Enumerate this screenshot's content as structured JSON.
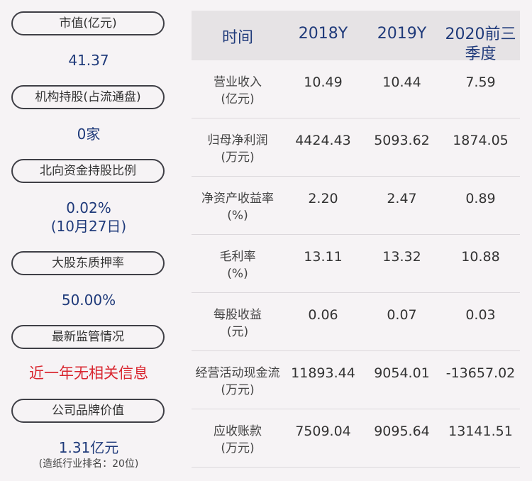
{
  "left": [
    {
      "label": "市值(亿元)",
      "value": "41.37"
    },
    {
      "label": "机构持股(占流通盘)",
      "value": "0家"
    },
    {
      "label": "北向资金持股比例",
      "value": "0.02%",
      "value2": "(10月27日)"
    },
    {
      "label": "大股东质押率",
      "value": "50.00%"
    },
    {
      "label": "最新监管情况",
      "value": "近一年无相关信息"
    },
    {
      "label": "公司品牌价值",
      "value": "1.31亿元",
      "note": "(造纸行业排名：20位)"
    }
  ],
  "table": {
    "headers": [
      "时间",
      "2018Y",
      "2019Y",
      "2020前三季度"
    ],
    "rows": [
      {
        "name": "营业收入",
        "unit": "(亿元)",
        "values": [
          "10.49",
          "10.44",
          "7.59"
        ]
      },
      {
        "name": "归母净利润",
        "unit": "(万元)",
        "values": [
          "4424.43",
          "5093.62",
          "1874.05"
        ]
      },
      {
        "name": "净资产收益率",
        "unit": "(%)",
        "values": [
          "2.20",
          "2.47",
          "0.89"
        ]
      },
      {
        "name": "毛利率",
        "unit": "(%)",
        "values": [
          "13.11",
          "13.32",
          "10.88"
        ]
      },
      {
        "name": "每股收益",
        "unit": "(元)",
        "values": [
          "0.06",
          "0.07",
          "0.03"
        ]
      },
      {
        "name": "经营活动现金流",
        "unit": "(万元)",
        "values": [
          "11893.44",
          "9054.01",
          "-13657.02"
        ]
      },
      {
        "name": "应收账款",
        "unit": "(万元)",
        "values": [
          "7509.04",
          "9095.64",
          "13141.51"
        ]
      }
    ]
  }
}
